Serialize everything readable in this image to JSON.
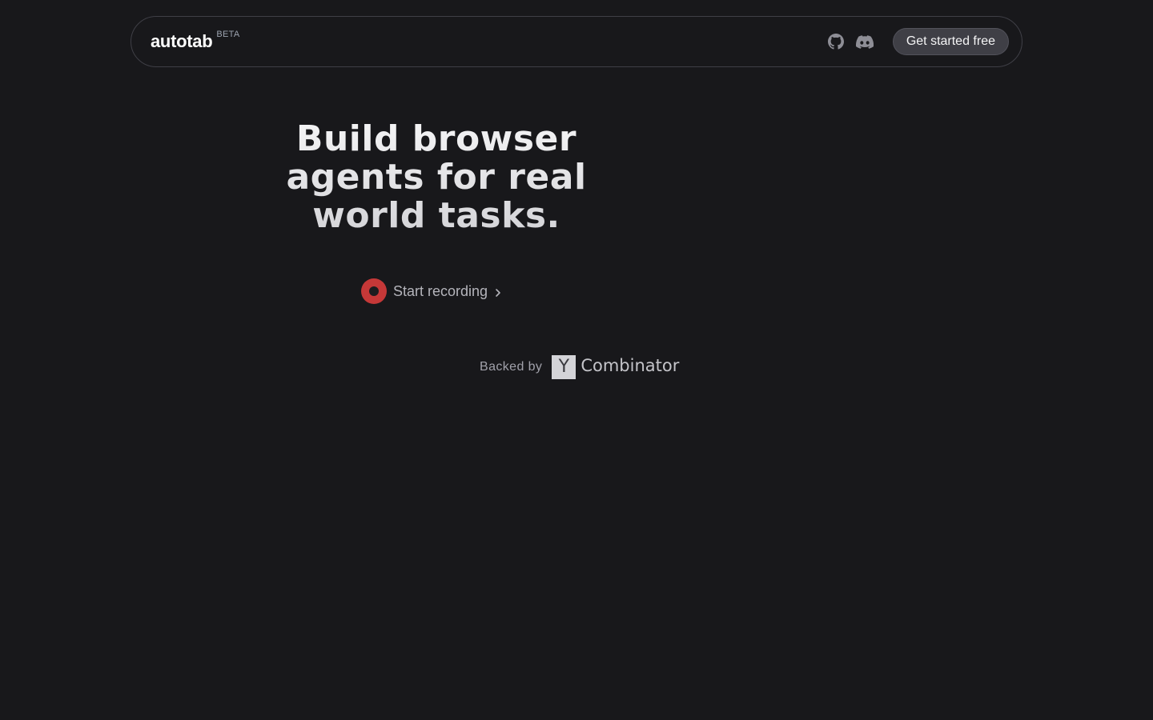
{
  "nav": {
    "brand": "autotab",
    "badge": "BETA",
    "icons": [
      "github-icon",
      "discord-icon"
    ],
    "cta_label": "Get started free"
  },
  "hero": {
    "title_line1": "Build browser",
    "title_line2": "agents for real",
    "title_line3": "world tasks."
  },
  "record": {
    "label": "Start recording",
    "icon": "record-icon",
    "accent": "#c53838"
  },
  "backed": {
    "label": "Backed by",
    "logo_letter": "Y",
    "logo_word": "Combinator"
  },
  "colors": {
    "background": "#18181b",
    "border": "#3f3f46",
    "button_bg": "#3f3f46"
  }
}
